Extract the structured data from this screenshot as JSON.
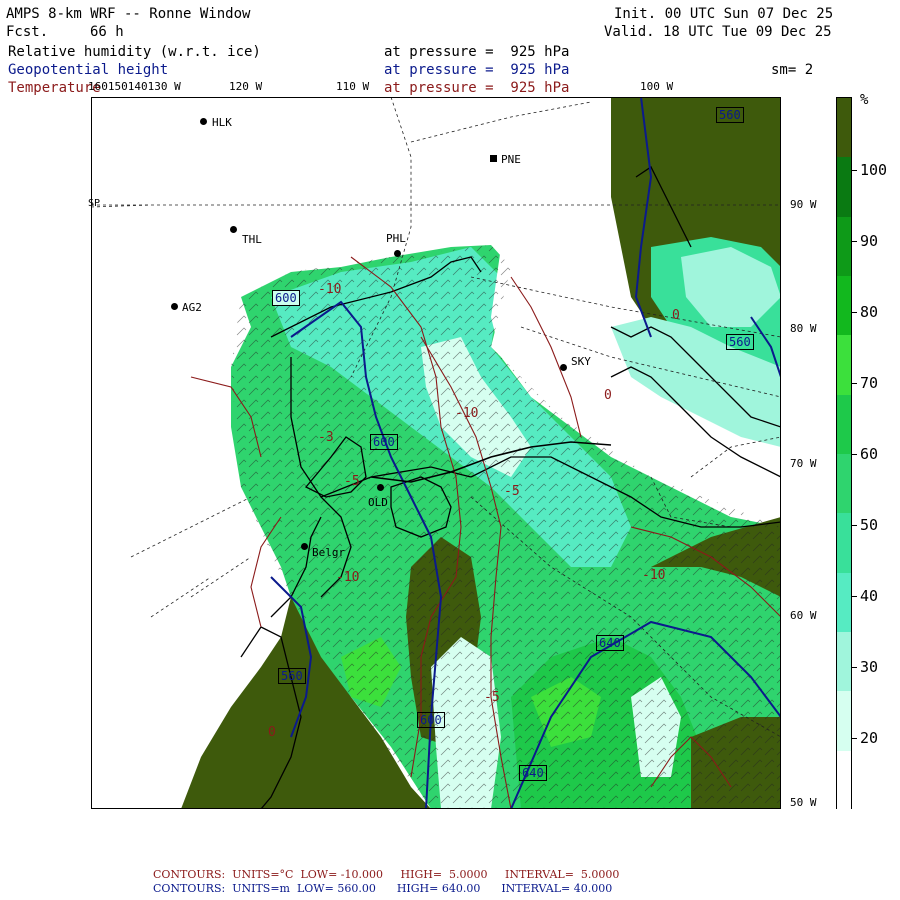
{
  "header": {
    "model_title": "AMPS 8-km WRF -- Ronne Window",
    "fcst_label": "Fcst.",
    "fcst_value": "66 h",
    "init": "Init. 00 UTC Sun 07 Dec 25",
    "valid": "Valid. 18 UTC Tue 09 Dec 25",
    "smoothing": "sm= 2"
  },
  "fields": [
    {
      "name": "Relative humidity (w.r.t. ice)",
      "level": "at pressure =  925 hPa",
      "color": "#000000"
    },
    {
      "name": "Geopotential height",
      "level": "at pressure =  925 hPa",
      "color": "#0b1a8c"
    },
    {
      "name": "Temperature",
      "level": "at pressure =  925 hPa",
      "color": "#8b1a1a"
    }
  ],
  "longitude_labels": {
    "crowded": "160150140130 W",
    "w120": "120 W",
    "w110": "110 W",
    "w100": "100 W"
  },
  "latitude_labels": [
    "90 W",
    "80 W",
    "70 W",
    "60 W",
    "50 W"
  ],
  "sp_label": "SP",
  "stations": [
    {
      "id": "HLK"
    },
    {
      "id": "PNE"
    },
    {
      "id": "THL"
    },
    {
      "id": "PHL"
    },
    {
      "id": "AG2"
    },
    {
      "id": "SKY"
    },
    {
      "id": "OLD"
    },
    {
      "id": "Belgr"
    }
  ],
  "contour_labels": {
    "blue": [
      "600",
      "560",
      "560",
      "600",
      "640",
      "600",
      "640",
      "560"
    ],
    "red": [
      "-10",
      "-10",
      "0",
      "-5",
      "0",
      "-5",
      "-10",
      "0",
      "-3",
      "-5",
      "-10"
    ]
  },
  "colorbar": {
    "unit": "%",
    "ticks": [
      "100",
      "90",
      "80",
      "70",
      "60",
      "50",
      "40",
      "30",
      "20"
    ],
    "colors": [
      "#ffffff",
      "#d6fff0",
      "#a0f5dc",
      "#56ebc2",
      "#39e09a",
      "#2fd46e",
      "#1ec94a",
      "#3ce03c",
      "#12b81e",
      "#0e9a18",
      "#0a7a12",
      "#3e5a0c"
    ]
  },
  "footer": {
    "temp": {
      "label": "CONTOURS:",
      "units": "UNITS=°C",
      "low": "LOW= -10.000",
      "high": "HIGH=  5.0000",
      "interval": "INTERVAL=  5.0000"
    },
    "hgt": {
      "label": "CONTOURS:",
      "units": "UNITS=m",
      "low": "LOW= 560.00",
      "high": "HIGH= 640.00",
      "interval": "INTERVAL= 40.000"
    }
  }
}
